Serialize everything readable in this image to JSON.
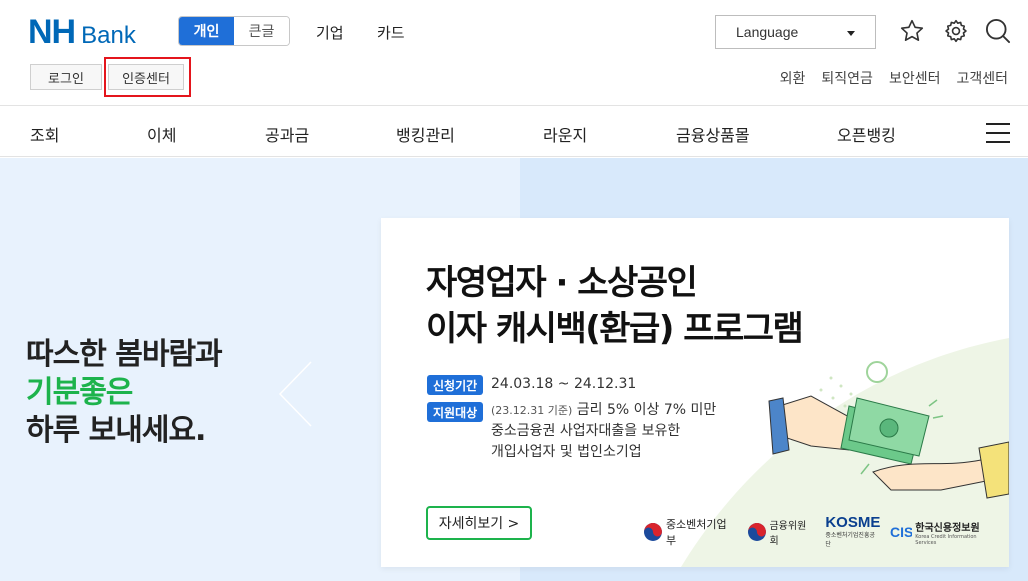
{
  "header": {
    "logo_nh": "NH",
    "logo_bank": "Bank",
    "segment": [
      {
        "label": "개인",
        "active": true
      },
      {
        "label": "큰글",
        "active": false
      }
    ],
    "top_nav": [
      "기업",
      "카드"
    ],
    "language_label": "Language",
    "login_label": "로그인",
    "cert_label": "인증센터",
    "util_links": [
      "외환",
      "퇴직연금",
      "보안센터",
      "고객센터"
    ]
  },
  "gnb": [
    "조회",
    "이체",
    "공과금",
    "뱅킹관리",
    "라운지",
    "금융상품몰",
    "오픈뱅킹"
  ],
  "hero": {
    "line1": "따스한 봄바람과",
    "line2": "기분좋은",
    "line3": "하루 보내세요."
  },
  "card": {
    "title_line1": "자영업자 · 소상공인",
    "title_line2": "이자 캐시백(환급) 프로그램",
    "badge_period": "신청기간",
    "period": "24.03.18 ~ 24.12.31",
    "badge_target": "지원대상",
    "target_note": "(23.12.31 기준)",
    "target_line1": "금리 5% 이상 7% 미만",
    "target_line2": "중소금융권 사업자대출을 보유한",
    "target_line3": "개입사업자 및 법인소기업",
    "detail_button": "자세히보기 >",
    "logos": {
      "mss": "중소벤처기업부",
      "fsc": "금융위원회",
      "kosme": "KOSME",
      "kosme_sub": "중소벤처기업진흥공단",
      "kcis": "한국신용정보원",
      "kcis_sub": "Korea Credit Information Services"
    }
  },
  "colors": {
    "brand": "#0068b7",
    "accent": "#1f6fd8",
    "green": "#1db34c",
    "highlight": "#e4151c"
  }
}
